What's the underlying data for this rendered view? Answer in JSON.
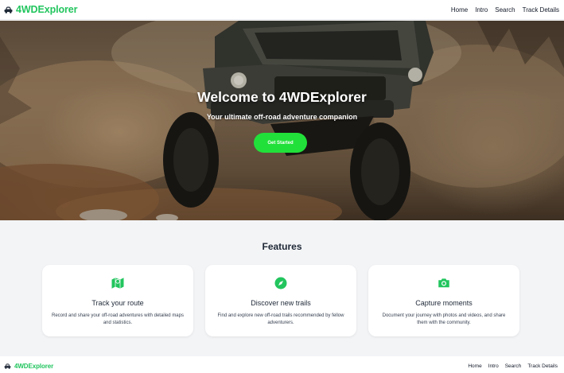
{
  "brand": {
    "name": "4WDExplorer",
    "icon": "car-icon",
    "color": "#22c55e"
  },
  "nav": {
    "links": [
      "Home",
      "Intro",
      "Search",
      "Track Details"
    ]
  },
  "hero": {
    "title": "Welcome to 4WDExplorer",
    "subtitle": "Your ultimate off-road adventure companion",
    "cta_label": "Get Started",
    "cta_color": "#22e03a"
  },
  "features": {
    "title": "Features",
    "items": [
      {
        "icon": "map-icon",
        "title": "Track your route",
        "description": "Record and share your off-road adventures with detailed maps and statistics."
      },
      {
        "icon": "compass-icon",
        "title": "Discover new trails",
        "description": "Find and explore new off-road trails recommended by fellow adventurers."
      },
      {
        "icon": "camera-icon",
        "title": "Capture moments",
        "description": "Document your journey with photos and videos, and share them with the community."
      }
    ]
  },
  "footer": {
    "brand": "4WDExplorer",
    "links": [
      "Home",
      "Intro",
      "Search",
      "Track Details"
    ]
  }
}
